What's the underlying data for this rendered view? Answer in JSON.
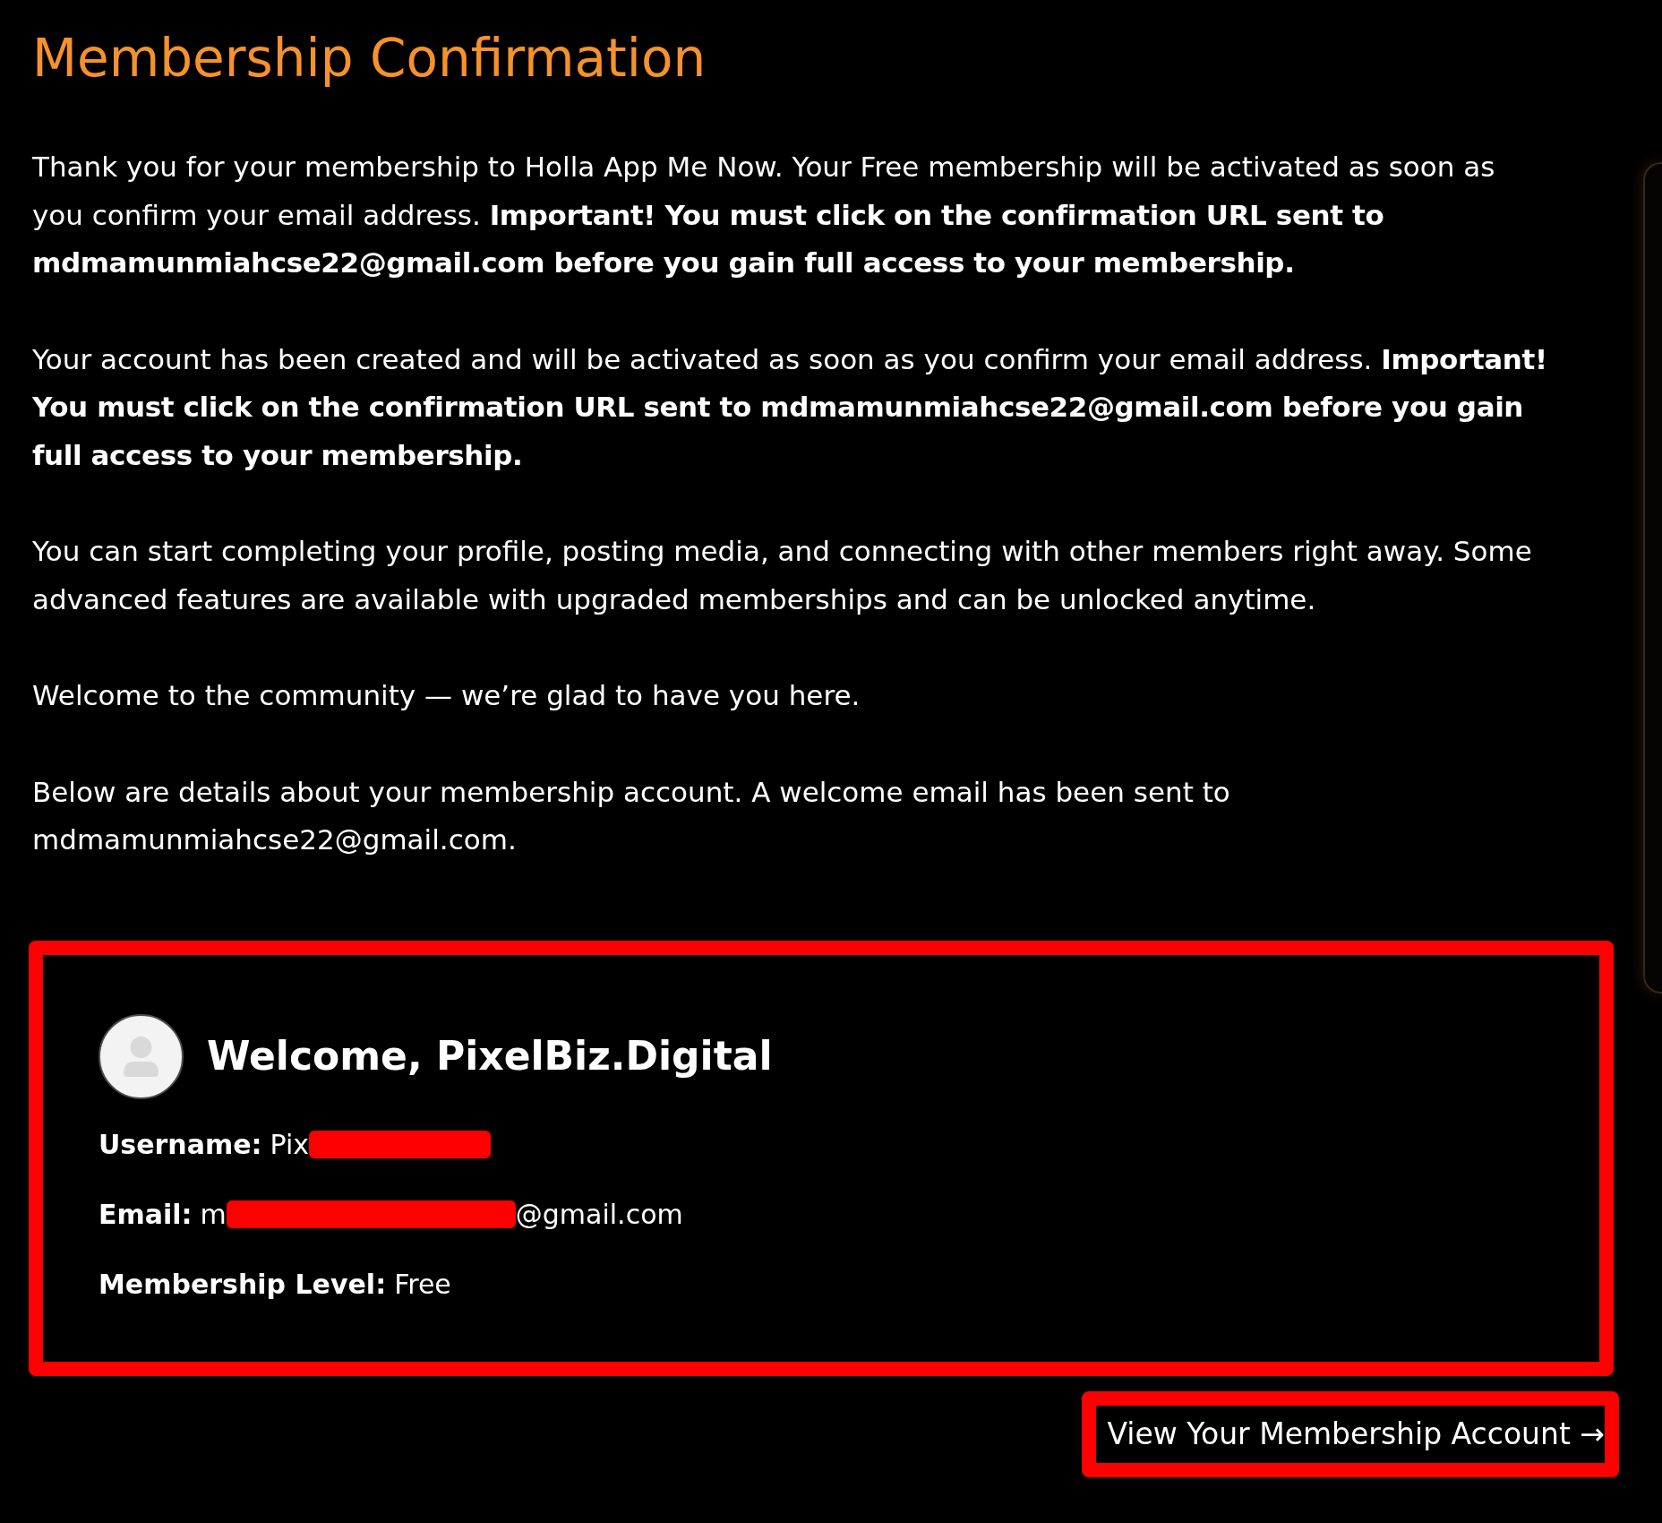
{
  "page": {
    "title": "Membership Confirmation"
  },
  "paragraphs": [
    "Thank you for your membership to Holla App Me Now. Your Free membership will be activated as soon as you confirm your email address. **Important! You must click on the confirmation URL sent to mdmamunmiahcse22@gmail.com before you gain full access to your membership.**",
    "Your account has been created and will be activated as soon as you confirm your email address. **Important! You must click on the confirmation URL sent to mdmamunmiahcse22@gmail.com before you gain full access to your membership.**",
    "You can start completing your profile, posting media, and connecting with other members right away. Some advanced features are available with upgraded memberships and can be unlocked anytime.",
    "Welcome to the community — we’re glad to have you here.",
    "Below are details about your membership account. A welcome email has been sent to mdmamunmiahcse22@gmail.com."
  ],
  "account_card": {
    "highlighted": true,
    "greeting": "Welcome, PixelBiz.Digital",
    "details": [
      {
        "label": "Username:",
        "segments": [
          {
            "kind": "text",
            "text": "Pix"
          },
          {
            "kind": "redaction"
          }
        ]
      },
      {
        "label": "Email:",
        "segments": [
          {
            "kind": "text",
            "text": "m"
          },
          {
            "kind": "redaction"
          },
          {
            "kind": "text",
            "text": "@gmail.com"
          }
        ]
      },
      {
        "label": "Membership Level:",
        "segments": [
          {
            "kind": "text",
            "text": "Free"
          }
        ]
      }
    ]
  },
  "account_link": {
    "label": "View Your Membership Account →",
    "highlighted": true
  }
}
